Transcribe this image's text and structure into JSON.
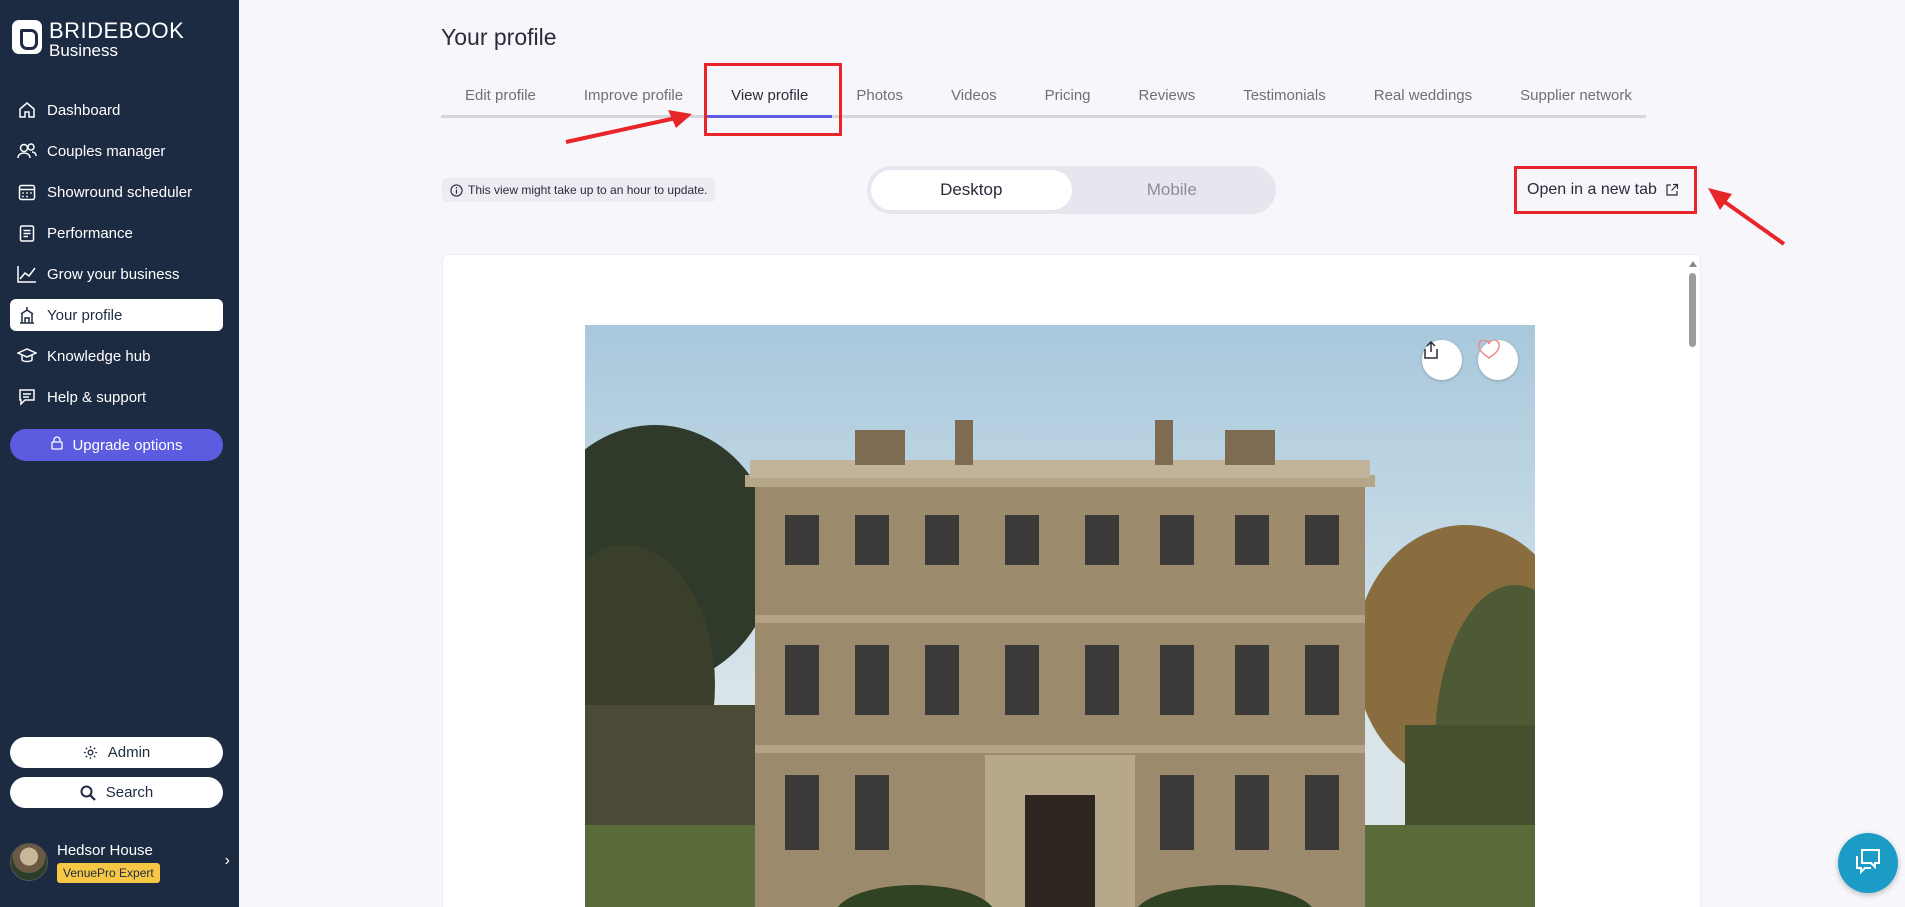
{
  "sidebar": {
    "brand": "BRIDEBOOK",
    "brand_sub": "Business",
    "items": [
      {
        "label": "Dashboard"
      },
      {
        "label": "Couples manager"
      },
      {
        "label": "Showround scheduler"
      },
      {
        "label": "Performance"
      },
      {
        "label": "Grow your business"
      },
      {
        "label": "Your profile"
      },
      {
        "label": "Knowledge hub"
      },
      {
        "label": "Help & support"
      }
    ],
    "upgrade_label": "Upgrade options",
    "admin_label": "Admin",
    "search_label": "Search",
    "account": {
      "name": "Hedsor House",
      "badge": "VenuePro Expert"
    }
  },
  "main": {
    "title": "Your profile",
    "tabs": [
      {
        "label": "Edit profile"
      },
      {
        "label": "Improve profile"
      },
      {
        "label": "View profile"
      },
      {
        "label": "Photos"
      },
      {
        "label": "Videos"
      },
      {
        "label": "Pricing"
      },
      {
        "label": "Reviews"
      },
      {
        "label": "Testimonials"
      },
      {
        "label": "Real weddings"
      },
      {
        "label": "Supplier network"
      }
    ],
    "active_tab": "View profile",
    "info_note": "This view might take up to an hour to update.",
    "toggle": {
      "desktop": "Desktop",
      "mobile": "Mobile",
      "selected": "Desktop"
    },
    "open_new_tab": "Open in a new tab"
  },
  "colors": {
    "sidebar_bg": "#1d2b42",
    "accent": "#5b5ce0",
    "highlight": "#e8262a",
    "badge": "#f6c744",
    "chat": "#1b9cc6"
  }
}
